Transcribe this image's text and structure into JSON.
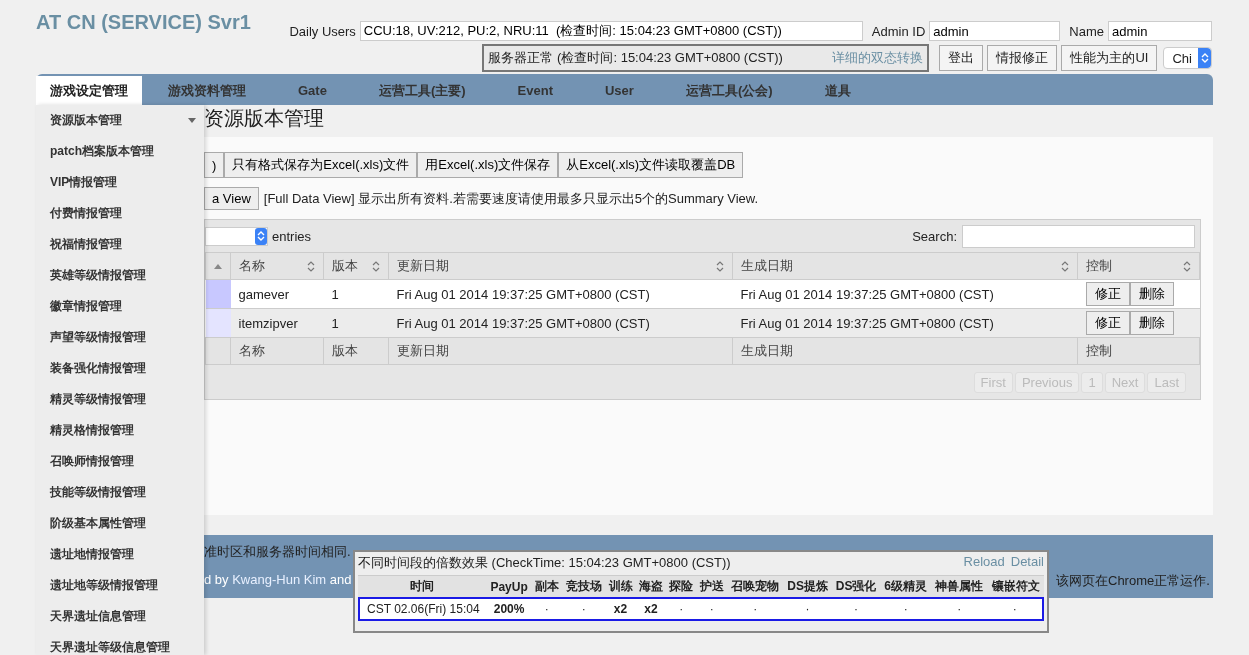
{
  "header": {
    "title": "AT CN (SERVICE) Svr1",
    "daily_users": {
      "label": "Daily Users",
      "value": "CCU:18, UV:212, PU:2, NRU:11  (检查时间: 15:04:23 GMT+0800 (CST))"
    },
    "admin_id": {
      "label": "Admin ID",
      "value": "admin"
    },
    "name": {
      "label": "Name",
      "value": "admin"
    },
    "status": {
      "text": "服务器正常  (检查时间: 15:04:23 GMT+0800 (CST))",
      "link": "详细的双态转换"
    },
    "buttons": [
      "登出",
      "情报修正",
      "性能为主的UI"
    ],
    "language": {
      "value": "Chi"
    }
  },
  "tabs": [
    {
      "label": "游戏设定管理",
      "selected": true
    },
    {
      "label": "游戏资料管理",
      "selected": false
    },
    {
      "label": "Gate",
      "selected": false
    },
    {
      "label": "运营工具(主要)",
      "selected": false
    },
    {
      "label": "Event",
      "selected": false
    },
    {
      "label": "User",
      "selected": false
    },
    {
      "label": "运营工具(公会)",
      "selected": false
    },
    {
      "label": "道具",
      "selected": false
    }
  ],
  "menu": {
    "items": [
      {
        "label": "资源版本管理",
        "expanded": true
      },
      {
        "label": "patch档案版本管理",
        "expanded": false
      },
      {
        "label": "VIP情报管理",
        "expanded": false
      },
      {
        "label": "付费情报管理",
        "expanded": false
      },
      {
        "label": "祝福情报管理",
        "expanded": false
      },
      {
        "label": "英雄等级情报管理",
        "expanded": false
      },
      {
        "label": "徽章情报管理",
        "expanded": false
      },
      {
        "label": "声望等级情报管理",
        "expanded": false
      },
      {
        "label": "装备强化情报管理",
        "expanded": false
      },
      {
        "label": "精灵等级情报管理",
        "expanded": false
      },
      {
        "label": "精灵格情报管理",
        "expanded": false
      },
      {
        "label": "召唤师情报管理",
        "expanded": false
      },
      {
        "label": "技能等级情报管理",
        "expanded": false
      },
      {
        "label": "阶级基本属性管理",
        "expanded": false
      },
      {
        "label": "遗址地情报管理",
        "expanded": false
      },
      {
        "label": "遗址地等级情报管理",
        "expanded": false
      },
      {
        "label": "天界遗址信息管理",
        "expanded": false
      },
      {
        "label": "天界遗址等级信息管理",
        "expanded": false
      }
    ]
  },
  "page": {
    "heading": "资源版本管理",
    "file_buttons": [
      ")",
      "只有格式保存为Excel(.xls)文件",
      "用Excel(.xls)文件保存",
      "从Excel(.xls)文件读取覆盖DB"
    ],
    "view_button": "a View",
    "view_note": "[Full Data View] 显示出所有资料.若需要速度请使用最多只显示出5个的Summary View.",
    "entries_label": "entries",
    "search_label": "Search:",
    "table": {
      "columns": [
        {
          "sorted_ascending": true
        },
        {
          "label": "名称",
          "sorted_ascending": false
        },
        {
          "label": "版本",
          "sorted_ascending": false
        },
        {
          "label": "更新日期",
          "sorted_ascending": false
        },
        {
          "label": "生成日期",
          "sorted_ascending": false
        },
        {
          "label": "控制",
          "sorted_ascending": false
        }
      ],
      "rows": [
        {
          "cells": [
            "",
            "gamever",
            "1",
            "Fri Aug 01 2014 19:37:25 GMT+0800 (CST)",
            "Fri Aug 01 2014 19:37:25 GMT+0800 (CST)"
          ],
          "actions": [
            "修正",
            "删除"
          ]
        },
        {
          "cells": [
            "",
            "itemzipver",
            "1",
            "Fri Aug 01 2014 19:37:25 GMT+0800 (CST)",
            "Fri Aug 01 2014 19:37:25 GMT+0800 (CST)"
          ],
          "actions": [
            "修正",
            "删除"
          ]
        }
      ],
      "footer_columns": [
        "名称",
        "版本",
        "更新日期",
        "生成日期",
        "控制"
      ]
    },
    "pagination": [
      {
        "label": "First",
        "disabled": true
      },
      {
        "label": "Previous",
        "disabled": true
      },
      {
        "label": "1",
        "disabled": true
      },
      {
        "label": "Next",
        "disabled": true
      },
      {
        "label": "Last",
        "disabled": true
      }
    ]
  },
  "footer": {
    "line_1": "准时区和服务器时间相同.",
    "line_2": {
      "before": "d by ",
      "link": "Kwang-Hun Kim",
      "after": " and"
    },
    "note": "该网页在Chrome正常运作."
  },
  "multiplier_popup": {
    "title": "不同时间段的倍数效果  (CheckTime: 15:04:23 GMT+0800 (CST))",
    "links": [
      "Reload",
      "Detail"
    ],
    "columns": [
      "时间",
      "PayUp",
      "副本",
      "竞技场",
      "训练",
      "海盗",
      "探险",
      "护送",
      "召唤宠物",
      "DS提炼",
      "DS强化",
      "6级精灵",
      "神兽属性",
      "镶嵌符文"
    ],
    "rows": [
      {
        "cells": [
          "CST 02.06(Fri) 15:04",
          "200%",
          "·",
          "·",
          "x2",
          "x2",
          "·",
          "·",
          "·",
          "·",
          "·",
          "·",
          "·",
          "·"
        ],
        "selected": true
      }
    ]
  }
}
